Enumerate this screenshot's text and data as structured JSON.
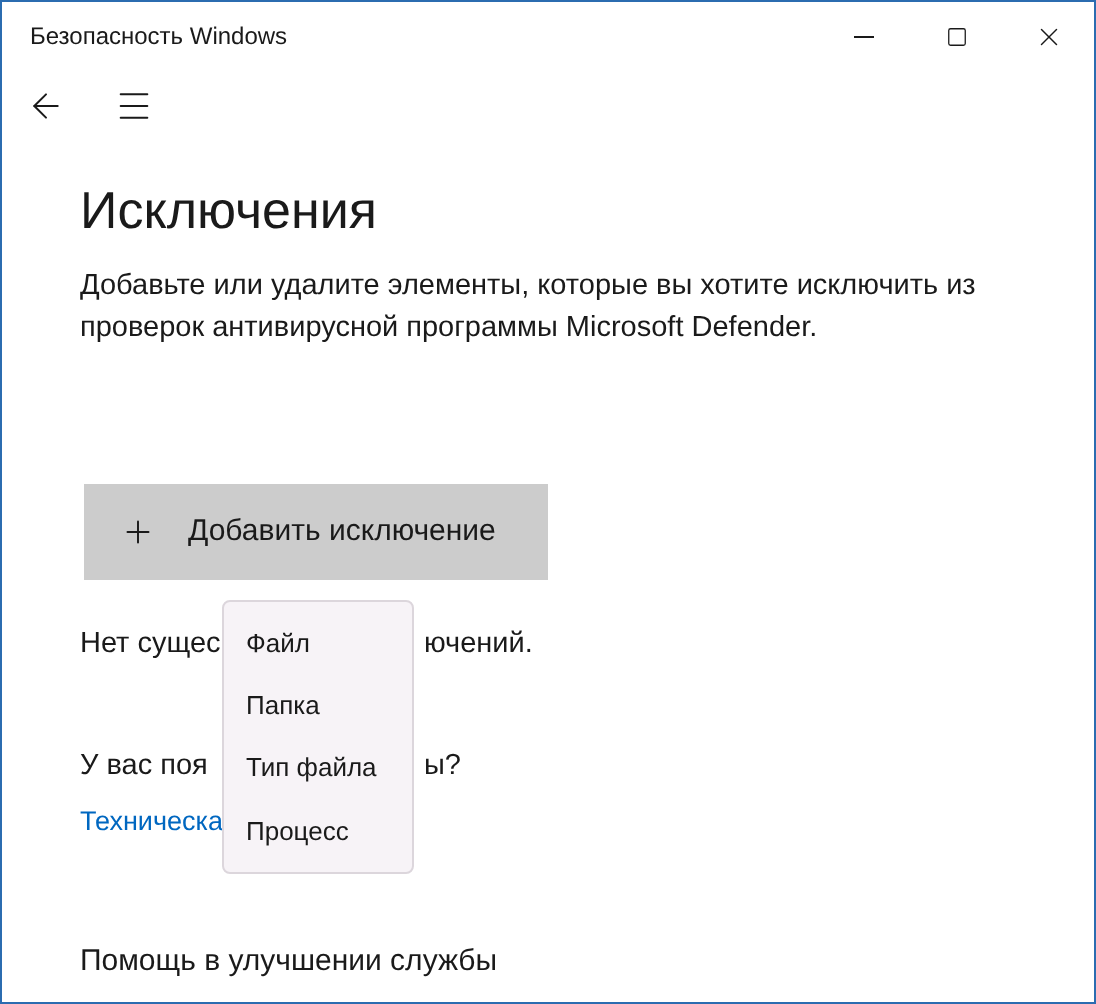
{
  "window": {
    "title": "Безопасность Windows"
  },
  "page": {
    "heading": "Исключения",
    "description": "Добавьте или удалите элементы, которые вы хотите исключить из проверок антивирусной программы Microsoft Defender.",
    "add_button": "Добавить исключение"
  },
  "status_visible": {
    "left": "Нет сущес",
    "right": "ючений."
  },
  "question_visible": {
    "left": "У вас поя",
    "right": "ы?"
  },
  "link_visible": "Техническа",
  "menu": [
    {
      "label": "Файл"
    },
    {
      "label": "Папка"
    },
    {
      "label": "Тип файла"
    },
    {
      "label": "Процесс"
    }
  ],
  "bottom_heading": "Помощь в улучшении службы"
}
